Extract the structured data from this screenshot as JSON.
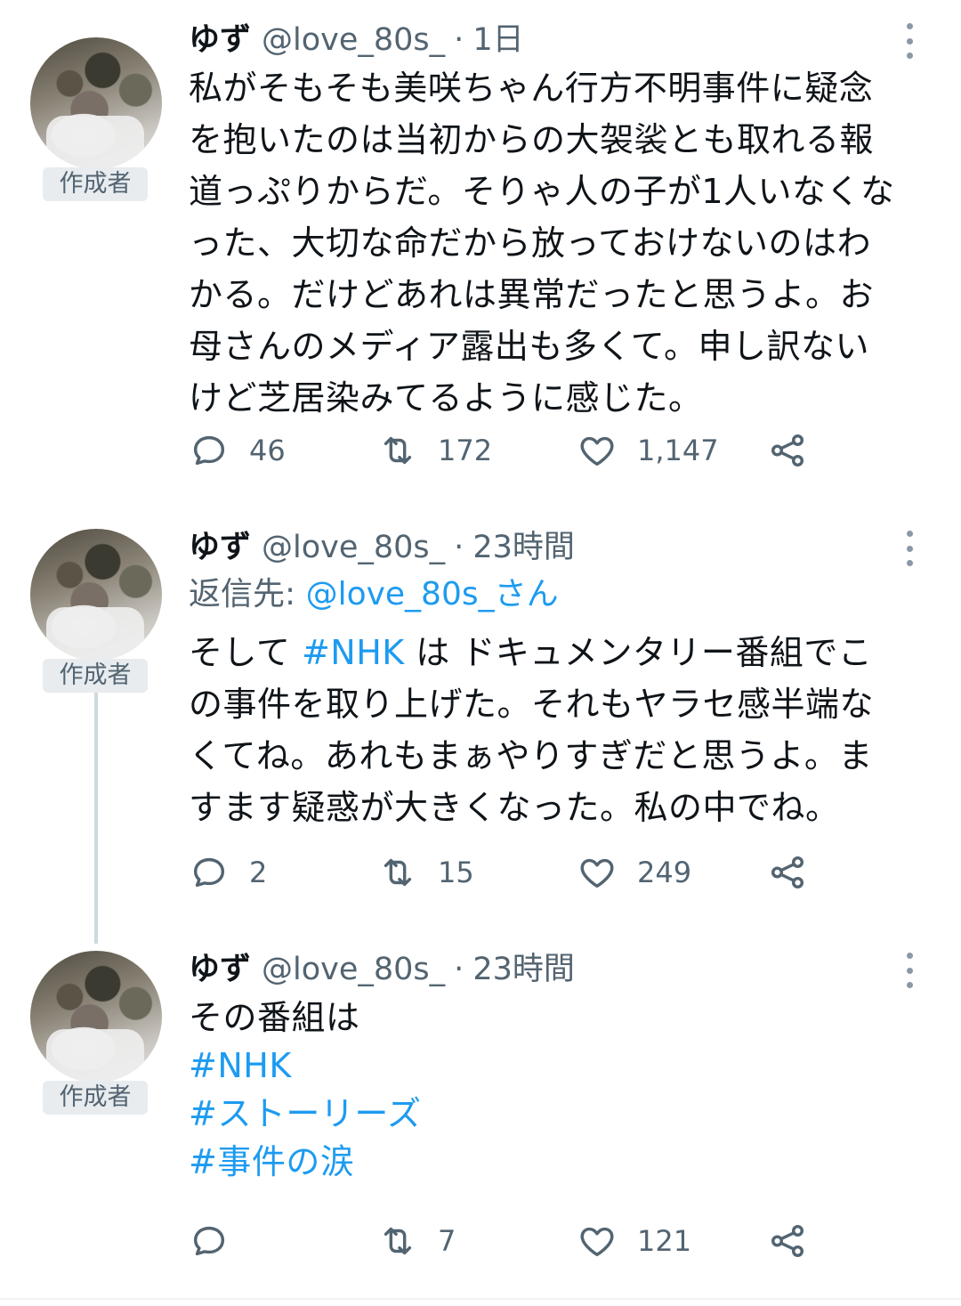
{
  "author_badge": "作成者",
  "tweets": [
    {
      "name": "ゆず",
      "handle": "@love_80s_",
      "dot": "·",
      "time": "1日",
      "body_lines": [
        "私がそもそも美咲ちゃん行方不明事件に疑念",
        "を抱いたのは当初からの大袈裟とも取れる報",
        "道っぷりからだ。そりゃ人の子が1人いなくな",
        "った、大切な命だから放っておけないのはわ",
        "かる。だけどあれは異常だったと思うよ。お",
        "母さんのメディア露出も多くて。申し訳ない",
        "けど芝居染みてるように感じた。"
      ],
      "replies": "46",
      "retweets": "172",
      "likes": "1,147"
    },
    {
      "name": "ゆず",
      "handle": "@love_80s_",
      "dot": "·",
      "time": "23時間",
      "reply_prefix": "返信先: ",
      "reply_mention": "@love_80s_さん",
      "line1_pre": "そして ",
      "line1_tag": "#NHK",
      "line1_post": " は ドキュメンタリー番組でこ",
      "body_lines": [
        "の事件を取り上げた。それもヤラセ感半端な",
        "くてね。あれもまぁやりすぎだと思うよ。ま",
        "すます疑惑が大きくなった。私の中でね。"
      ],
      "replies": "2",
      "retweets": "15",
      "likes": "249"
    },
    {
      "name": "ゆず",
      "handle": "@love_80s_",
      "dot": "·",
      "time": "23時間",
      "body_first": "その番組は",
      "hashtags": [
        "#NHK",
        "#ストーリーズ",
        "#事件の涙"
      ],
      "replies": "",
      "retweets": "7",
      "likes": "121"
    }
  ],
  "icons": {
    "reply": "reply-bubble-icon",
    "retweet": "retweet-icon",
    "like": "heart-icon",
    "share": "share-icon",
    "more": "more-vertical-icon"
  },
  "colors": {
    "text": "#0f1419",
    "muted": "#536471",
    "link": "#1d9bf0",
    "badge_bg": "#e8ecef"
  }
}
